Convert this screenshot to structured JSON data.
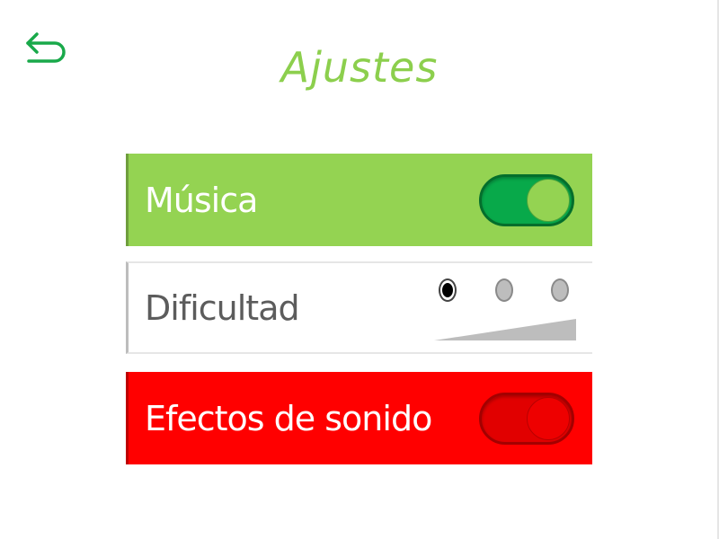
{
  "header": {
    "title": "Ajustes",
    "back_icon": "back-arrow-icon"
  },
  "settings": {
    "music": {
      "label": "Música",
      "enabled": true,
      "colors": {
        "row": "#94d352",
        "toggle_track": "#08a94a",
        "toggle_knob": "#94d352"
      }
    },
    "difficulty": {
      "label": "Dificultad",
      "levels": 3,
      "selected_level": 1
    },
    "sound_effects": {
      "label": "Efectos de sonido",
      "enabled": false,
      "colors": {
        "row": "#ff0000",
        "toggle_track": "#e10000",
        "toggle_knob": "#ee0000"
      }
    }
  },
  "colors": {
    "title": "#8ccf4d",
    "back_icon": "#19a94a",
    "difficulty_ramp": "#bdbdbd"
  }
}
